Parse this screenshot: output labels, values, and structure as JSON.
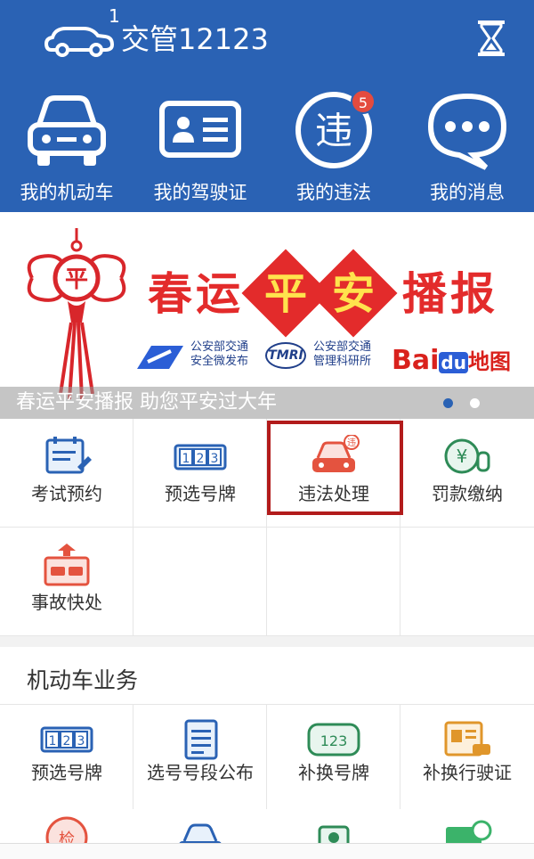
{
  "header": {
    "title": "交管12123",
    "logo_icon": "car-cloud-logo-icon",
    "right_icon": "hourglass-icon",
    "color": "#2a62b4",
    "items": [
      {
        "label": "我的机动车",
        "icon": "car-icon",
        "badge": "1"
      },
      {
        "label": "我的驾驶证",
        "icon": "license-card-icon"
      },
      {
        "label": "我的违法",
        "icon": "violation-icon",
        "icon_text": "违",
        "badge": "5"
      },
      {
        "label": "我的消息",
        "icon": "message-bubble-icon"
      }
    ]
  },
  "banner": {
    "title": [
      "春",
      "运",
      "平",
      "安",
      "播",
      "报"
    ],
    "orgs": [
      {
        "line1": "公安部交通",
        "line2": "安全微发布",
        "logo": "arrow-logo-icon"
      },
      {
        "line1": "公安部交通",
        "line2": "管理科研所",
        "logo": "TMRI"
      }
    ],
    "baidu": {
      "bai": "Bai",
      "du": "du",
      "map": "地图"
    },
    "caption": "春运平安播报 助您平安过大年",
    "knot_icon": "chinese-knot-icon",
    "knot_text": "平",
    "dots": [
      {
        "active": true
      },
      {
        "active": false
      }
    ]
  },
  "services": [
    {
      "label": "考试预约",
      "icon": "exam-calendar-icon"
    },
    {
      "label": "预选号牌",
      "icon": "plate-123-icon",
      "icon_text": [
        "1",
        "2",
        "3"
      ]
    },
    {
      "label": "违法处理",
      "icon": "car-violation-icon",
      "icon_text": "违",
      "highlighted": true
    },
    {
      "label": "罚款缴纳",
      "icon": "yen-coins-icon",
      "icon_text": "¥"
    },
    {
      "label": "事故快处",
      "icon": "accident-icon"
    }
  ],
  "vehicle_section": {
    "title": "机动车业务",
    "items": [
      {
        "label": "预选号牌",
        "icon": "plate-123-icon",
        "icon_text": [
          "1",
          "2",
          "3"
        ]
      },
      {
        "label": "选号号段公布",
        "icon": "document-list-icon"
      },
      {
        "label": "补换号牌",
        "icon": "plate-123-oval-icon",
        "icon_text": "123"
      },
      {
        "label": "补换行驶证",
        "icon": "license-car-icon"
      }
    ],
    "partial_icons": [
      "inspection-icon",
      "car-icon",
      "document-icon",
      "phone-icon",
      "green-card-icon"
    ],
    "partial_text": "检"
  }
}
